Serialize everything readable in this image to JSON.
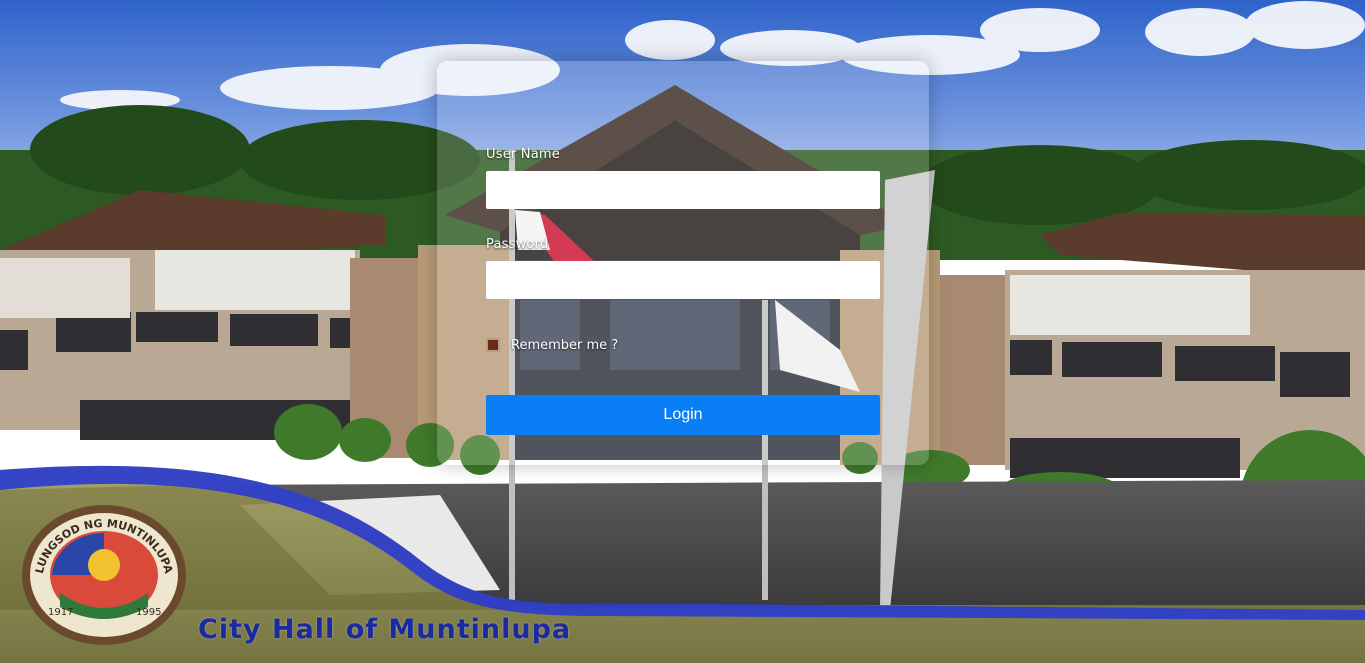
{
  "login": {
    "username_label": "User Name",
    "username_value": "",
    "password_label": "Password",
    "password_value": "",
    "remember_label": "Remember me ?",
    "remember_checked": false,
    "submit_label": "Login"
  },
  "footer": {
    "title": "City Hall of Muntinlupa"
  },
  "seal": {
    "text_top": "LUNGSOD NG MUNTINLUPA",
    "year_left": "1917",
    "year_right": "1995"
  },
  "colors": {
    "login_button": "#0a7ff5",
    "banner_blue": "#2a3bd0",
    "banner_olive": "#8c8a4a",
    "footer_text": "#1a2aa0"
  }
}
